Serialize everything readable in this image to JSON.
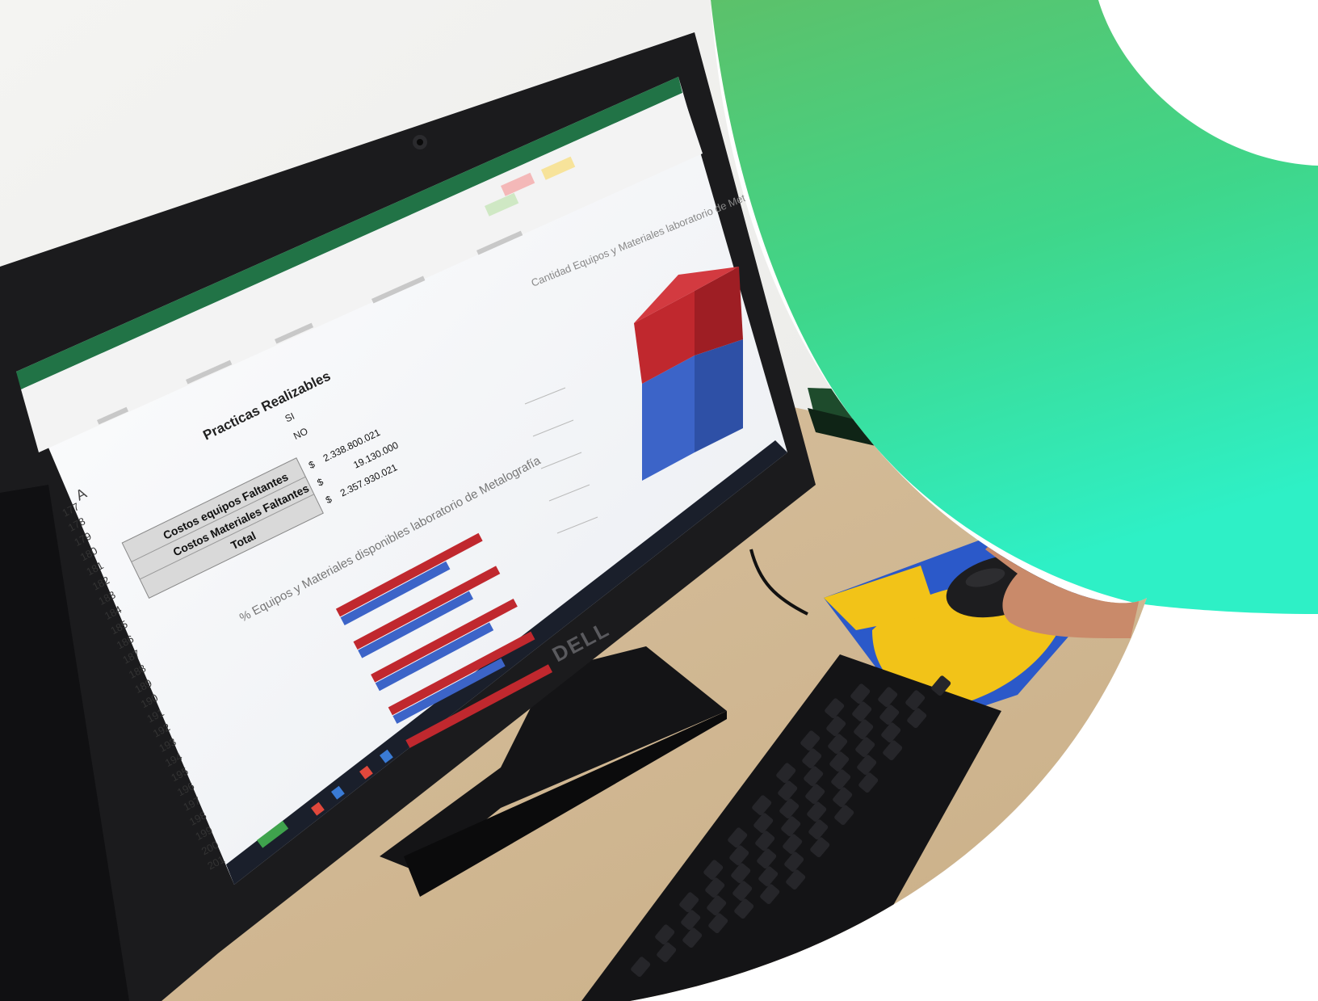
{
  "colors": {
    "green_gradient_top": "#5cc16a",
    "green_gradient_mid": "#3fd68a",
    "green_gradient_bottom": "#2ef0c6",
    "excel_green": "#217346",
    "bar_red": "#c0282e",
    "bar_blue": "#3c64c8",
    "desk": "#d9c3a2",
    "wall": "#f2f2f0",
    "monitor": "#1b1b1d",
    "mousepad_yellow": "#f2c318",
    "mousepad_blue": "#2b59c9"
  },
  "monitor": {
    "brand": "DELL"
  },
  "spreadsheet": {
    "table": {
      "header": "Practicas Realizables",
      "rows": [
        {
          "label": "SI"
        },
        {
          "label": "NO"
        }
      ]
    },
    "cost_rows": [
      {
        "label": "Costos equipos Faltantes",
        "currency": "$",
        "value": "2.338.800.021"
      },
      {
        "label": "Costos Materiales Faltantes",
        "currency": "$",
        "value": "19.130.000"
      },
      {
        "label": "Total",
        "currency": "$",
        "value": "2.357.930.021"
      }
    ],
    "column_letter": "A",
    "row_numbers": [
      "177",
      "178",
      "179",
      "180",
      "181",
      "182",
      "183",
      "184",
      "185",
      "186",
      "187",
      "188",
      "189",
      "190",
      "191",
      "192",
      "193",
      "194",
      "195",
      "196",
      "197",
      "198",
      "199",
      "200",
      "201"
    ],
    "bar_chart_title": "% Equipos y Materiales disponibles laboratorio de Metalografía",
    "cube_chart_title": "Cantidad Equipos y Materiales laboratorio de Metalografía"
  },
  "chart_data": {
    "type": "bar",
    "title": "% Equipos y Materiales disponibles laboratorio de Metalografía",
    "series": [
      {
        "color": "#c0282e",
        "values": [
          100,
          100,
          100,
          100,
          100
        ]
      },
      {
        "color": "#3c64c8",
        "values": [
          74,
          78,
          80,
          76,
          0
        ]
      }
    ],
    "xlim": [
      0,
      100
    ]
  }
}
